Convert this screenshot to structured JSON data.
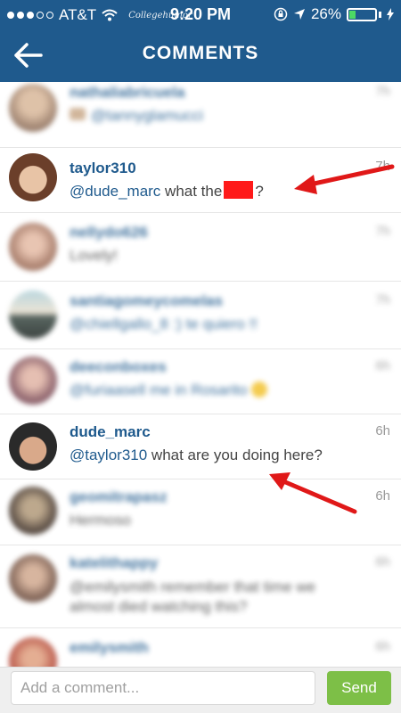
{
  "status_bar": {
    "carrier": "AT&T",
    "watermark": "Collegehumor",
    "time": "9:20 PM",
    "battery": "26%",
    "battery_level": 0.26
  },
  "header": {
    "title": "COMMENTS"
  },
  "comments": [
    {
      "username": "nathaliabricuela",
      "text": "@tannyglamucci",
      "time": "7h",
      "blurred": true
    },
    {
      "username": "taylor310",
      "mention": "@dude_marc",
      "text": " what the",
      "suffix": "?",
      "time": "7h",
      "blurred": false
    },
    {
      "username": "nellydo626",
      "text": "Lovely!",
      "time": "7h",
      "blurred": true
    },
    {
      "username": "santiagomeycomelas",
      "text": "@chiellgallo_8 :) te quiero !!",
      "time": "7h",
      "blurred": true
    },
    {
      "username": "deeconboxes",
      "text": "@furiaasell me in Rosarito",
      "time": "6h",
      "blurred": true
    },
    {
      "username": "dude_marc",
      "mention": "@taylor310",
      "text": " what are you doing here?",
      "time": "6h",
      "blurred": false
    },
    {
      "username": "geomitrapasz",
      "text": "Hermoso",
      "time": "6h",
      "blurred": true
    },
    {
      "username": "katelithappy",
      "text": "@emilysmith remember that time we almost died watching this?",
      "time": "6h",
      "blurred": true
    },
    {
      "username": "emilysmith",
      "text": "",
      "time": "6h",
      "blurred": true
    }
  ],
  "composer": {
    "placeholder": "Add a comment...",
    "send_label": "Send"
  },
  "colors": {
    "brand": "#1f5a8d",
    "send": "#7dbf47",
    "annotation": "#e01818"
  }
}
